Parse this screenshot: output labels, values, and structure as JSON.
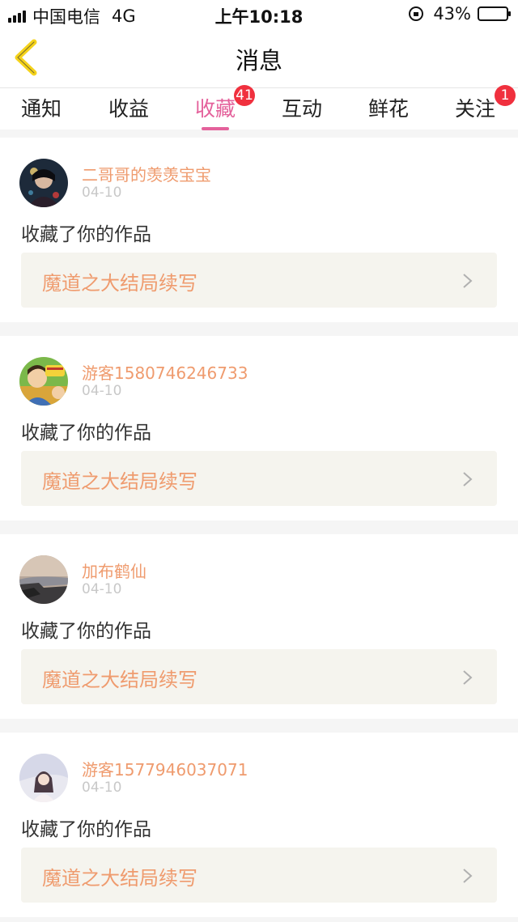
{
  "status_bar": {
    "carrier": "中国电信",
    "network": "4G",
    "time": "上午10:18",
    "battery": "43%",
    "battery_level": 0.43
  },
  "nav": {
    "title": "消息",
    "back_icon": "chevron-left-icon",
    "accent_color": "#f5d31b"
  },
  "tabs": [
    {
      "label": "通知",
      "active": false
    },
    {
      "label": "收益",
      "active": false
    },
    {
      "label": "收藏",
      "active": true,
      "badge": "41"
    },
    {
      "label": "互动",
      "active": false
    },
    {
      "label": "鲜花",
      "active": false
    },
    {
      "label": "关注",
      "active": false,
      "badge": "1"
    }
  ],
  "colors": {
    "active_tab": "#e4619b",
    "username": "#ef9b6e",
    "badge": "#f0303e",
    "work_link_bg": "#f5f4ee"
  },
  "messages": [
    {
      "username": "二哥哥的羡羡宝宝",
      "date": "04-10",
      "text": "收藏了你的作品",
      "work_title": "魔道之大结局续写"
    },
    {
      "username": "游客1580746246733",
      "date": "04-10",
      "text": "收藏了你的作品",
      "work_title": "魔道之大结局续写"
    },
    {
      "username": "加布鹤仙",
      "date": "04-10",
      "text": "收藏了你的作品",
      "work_title": "魔道之大结局续写"
    },
    {
      "username": "游客1577946037071",
      "date": "04-10",
      "text": "收藏了你的作品",
      "work_title": "魔道之大结局续写"
    }
  ]
}
